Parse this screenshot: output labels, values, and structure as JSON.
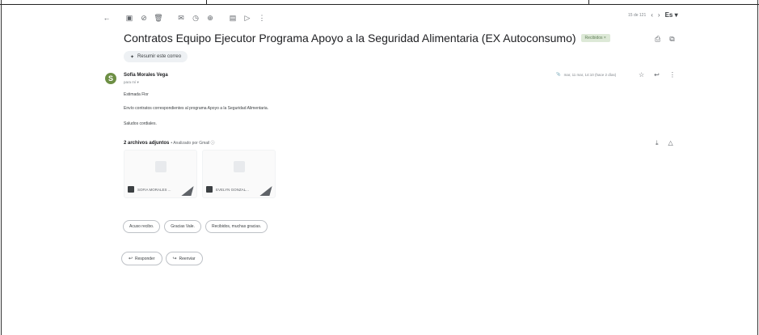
{
  "toolbar": {
    "icons": [
      "back-arrow-icon",
      "archive-icon",
      "report-spam-icon",
      "delete-icon",
      "mark-unread-icon",
      "snooze-icon",
      "add-to-tasks-icon",
      "move-to-icon",
      "label-icon",
      "more-vert-icon"
    ],
    "pager_text": "15 de 121",
    "prev_glyph": "‹",
    "next_glyph": "›",
    "language": "Es"
  },
  "email": {
    "subject": "Contratos Equipo Ejecutor Programa Apoyo a la Seguridad Alimentaria (EX Autoconsumo)",
    "label": "Recibidos ×",
    "summarize_label": "Resumir este correo",
    "sender": {
      "initial": "S",
      "name": "Sofía Morales Vega",
      "to": "para mí ▾",
      "date": "mar, 11 mar, 14:10 (hace 2 días)"
    },
    "body": [
      "Estimada Flor",
      "Envío contratos correspondientes al programa Apoyo a la Seguridad Alimentaria.",
      "Saludos cordiales."
    ],
    "attachments": {
      "title": "2 archivos adjuntos",
      "scanned": " • Analizado por Gmail ⓘ",
      "files": [
        {
          "name": "SOFIA MORALES ..."
        },
        {
          "name": "EVELYN GONZAL..."
        }
      ]
    },
    "smart_replies": [
      "Acuso recibo.",
      "Gracias Vale.",
      "Recibidos, muchas gracias."
    ],
    "actions": {
      "reply": "Responder",
      "forward": "Reenviar"
    }
  },
  "colors": {
    "avatar_bg": "#6d8f44",
    "label_bg": "#dde9d7"
  }
}
